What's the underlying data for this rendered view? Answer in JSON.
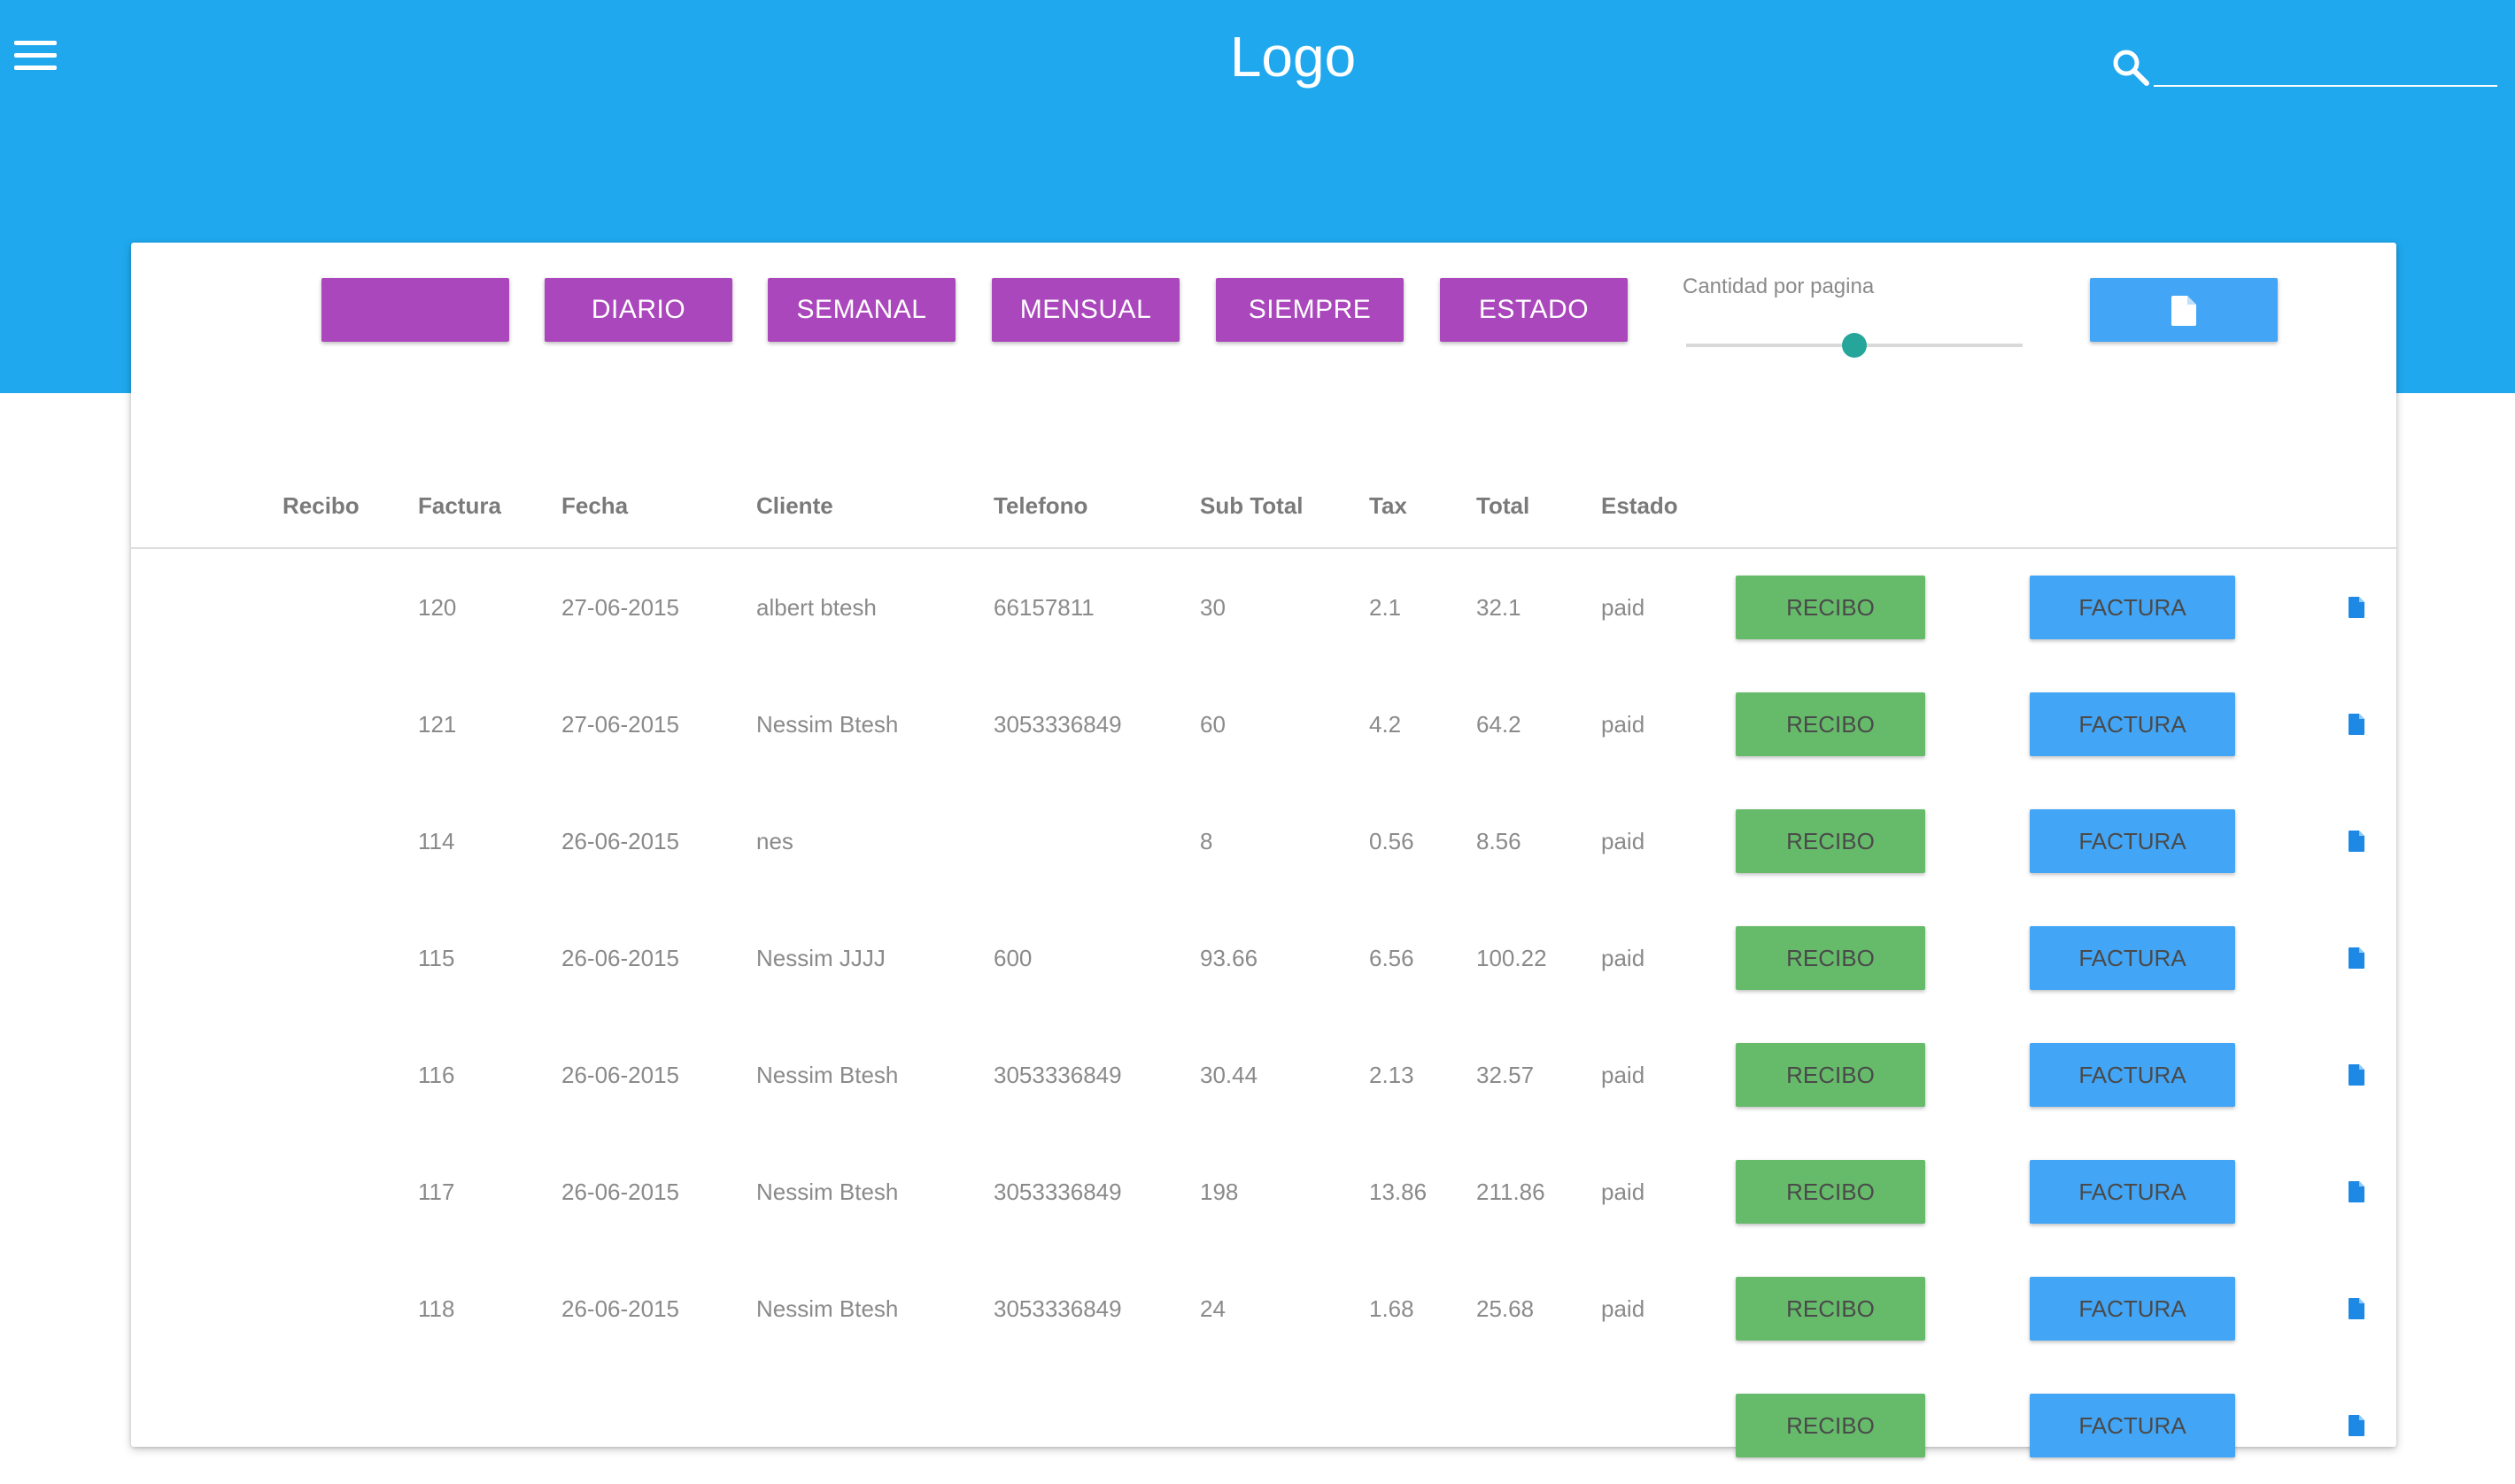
{
  "header": {
    "title": "Logo",
    "menu_icon": "hamburger-menu-icon",
    "search_icon": "search-icon",
    "search_placeholder": "",
    "search_value": "",
    "background_color": "#1fa8ee"
  },
  "filters": {
    "buttons": [
      "",
      "DIARIO",
      "SEMANAL",
      "MENSUAL",
      "SIEMPRE",
      "ESTADO"
    ],
    "color": "#ab47bc"
  },
  "pagination": {
    "label": "Cantidad por pagina",
    "slider_fraction": 0.5
  },
  "export_button": {
    "icon": "file-icon",
    "color": "#42a5f5"
  },
  "table": {
    "columns": [
      "Recibo",
      "Factura",
      "Fecha",
      "Cliente",
      "Telefono",
      "Sub Total",
      "Tax",
      "Total",
      "Estado"
    ],
    "recibo_label": "RECIBO",
    "factura_label": "FACTURA",
    "recibo_color": "#66bb6a",
    "factura_color": "#42a5f5",
    "row_icon": "file-icon",
    "rows": [
      {
        "recibo": "",
        "factura": "120",
        "fecha": "27-06-2015",
        "cliente": "albert btesh",
        "telefono": "66157811",
        "subtotal": "30",
        "tax": "2.1",
        "total": "32.1",
        "estado": "paid"
      },
      {
        "recibo": "",
        "factura": "121",
        "fecha": "27-06-2015",
        "cliente": "Nessim Btesh",
        "telefono": "3053336849",
        "subtotal": "60",
        "tax": "4.2",
        "total": "64.2",
        "estado": "paid"
      },
      {
        "recibo": "",
        "factura": "114",
        "fecha": "26-06-2015",
        "cliente": "nes",
        "telefono": "",
        "subtotal": "8",
        "tax": "0.56",
        "total": "8.56",
        "estado": "paid"
      },
      {
        "recibo": "",
        "factura": "115",
        "fecha": "26-06-2015",
        "cliente": "Nessim JJJJ",
        "telefono": "600",
        "subtotal": "93.66",
        "tax": "6.56",
        "total": "100.22",
        "estado": "paid"
      },
      {
        "recibo": "",
        "factura": "116",
        "fecha": "26-06-2015",
        "cliente": "Nessim Btesh",
        "telefono": "3053336849",
        "subtotal": "30.44",
        "tax": "2.13",
        "total": "32.57",
        "estado": "paid"
      },
      {
        "recibo": "",
        "factura": "117",
        "fecha": "26-06-2015",
        "cliente": "Nessim Btesh",
        "telefono": "3053336849",
        "subtotal": "198",
        "tax": "13.86",
        "total": "211.86",
        "estado": "paid"
      },
      {
        "recibo": "",
        "factura": "118",
        "fecha": "26-06-2015",
        "cliente": "Nessim Btesh",
        "telefono": "3053336849",
        "subtotal": "24",
        "tax": "1.68",
        "total": "25.68",
        "estado": "paid"
      },
      {
        "recibo": "",
        "factura": "",
        "fecha": "",
        "cliente": "",
        "telefono": "",
        "subtotal": "",
        "tax": "",
        "total": "",
        "estado": ""
      }
    ]
  }
}
